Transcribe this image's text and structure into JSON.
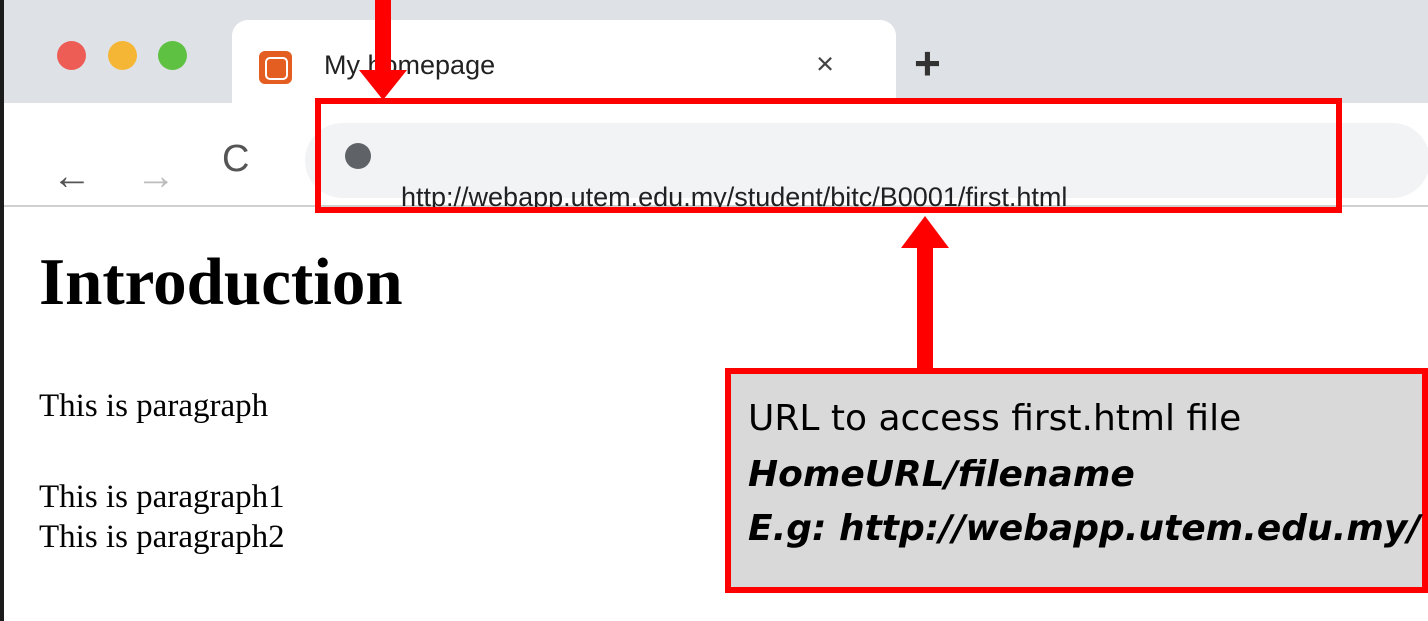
{
  "browser": {
    "tab_title": "My homepage",
    "tab_close": "×",
    "new_tab": "+",
    "url": "http://webapp.utem.edu.my/student/bitc/B0001/first.html",
    "nav": {
      "back": "←",
      "forward": "→",
      "reload": "C"
    }
  },
  "page": {
    "heading": "Introduction",
    "paragraphs": [
      "This is paragraph",
      "This is paragraph1",
      "This is paragraph2"
    ]
  },
  "annotation": {
    "callout_line1": "URL to access first.html file",
    "callout_line2": "HomeURL/filename",
    "callout_line3": "E.g: http://webapp.utem.edu.my/"
  },
  "colors": {
    "annotation_red": "#ff0000",
    "tabstrip_gray": "#dee1e6",
    "callout_gray": "#d9d9d9"
  }
}
